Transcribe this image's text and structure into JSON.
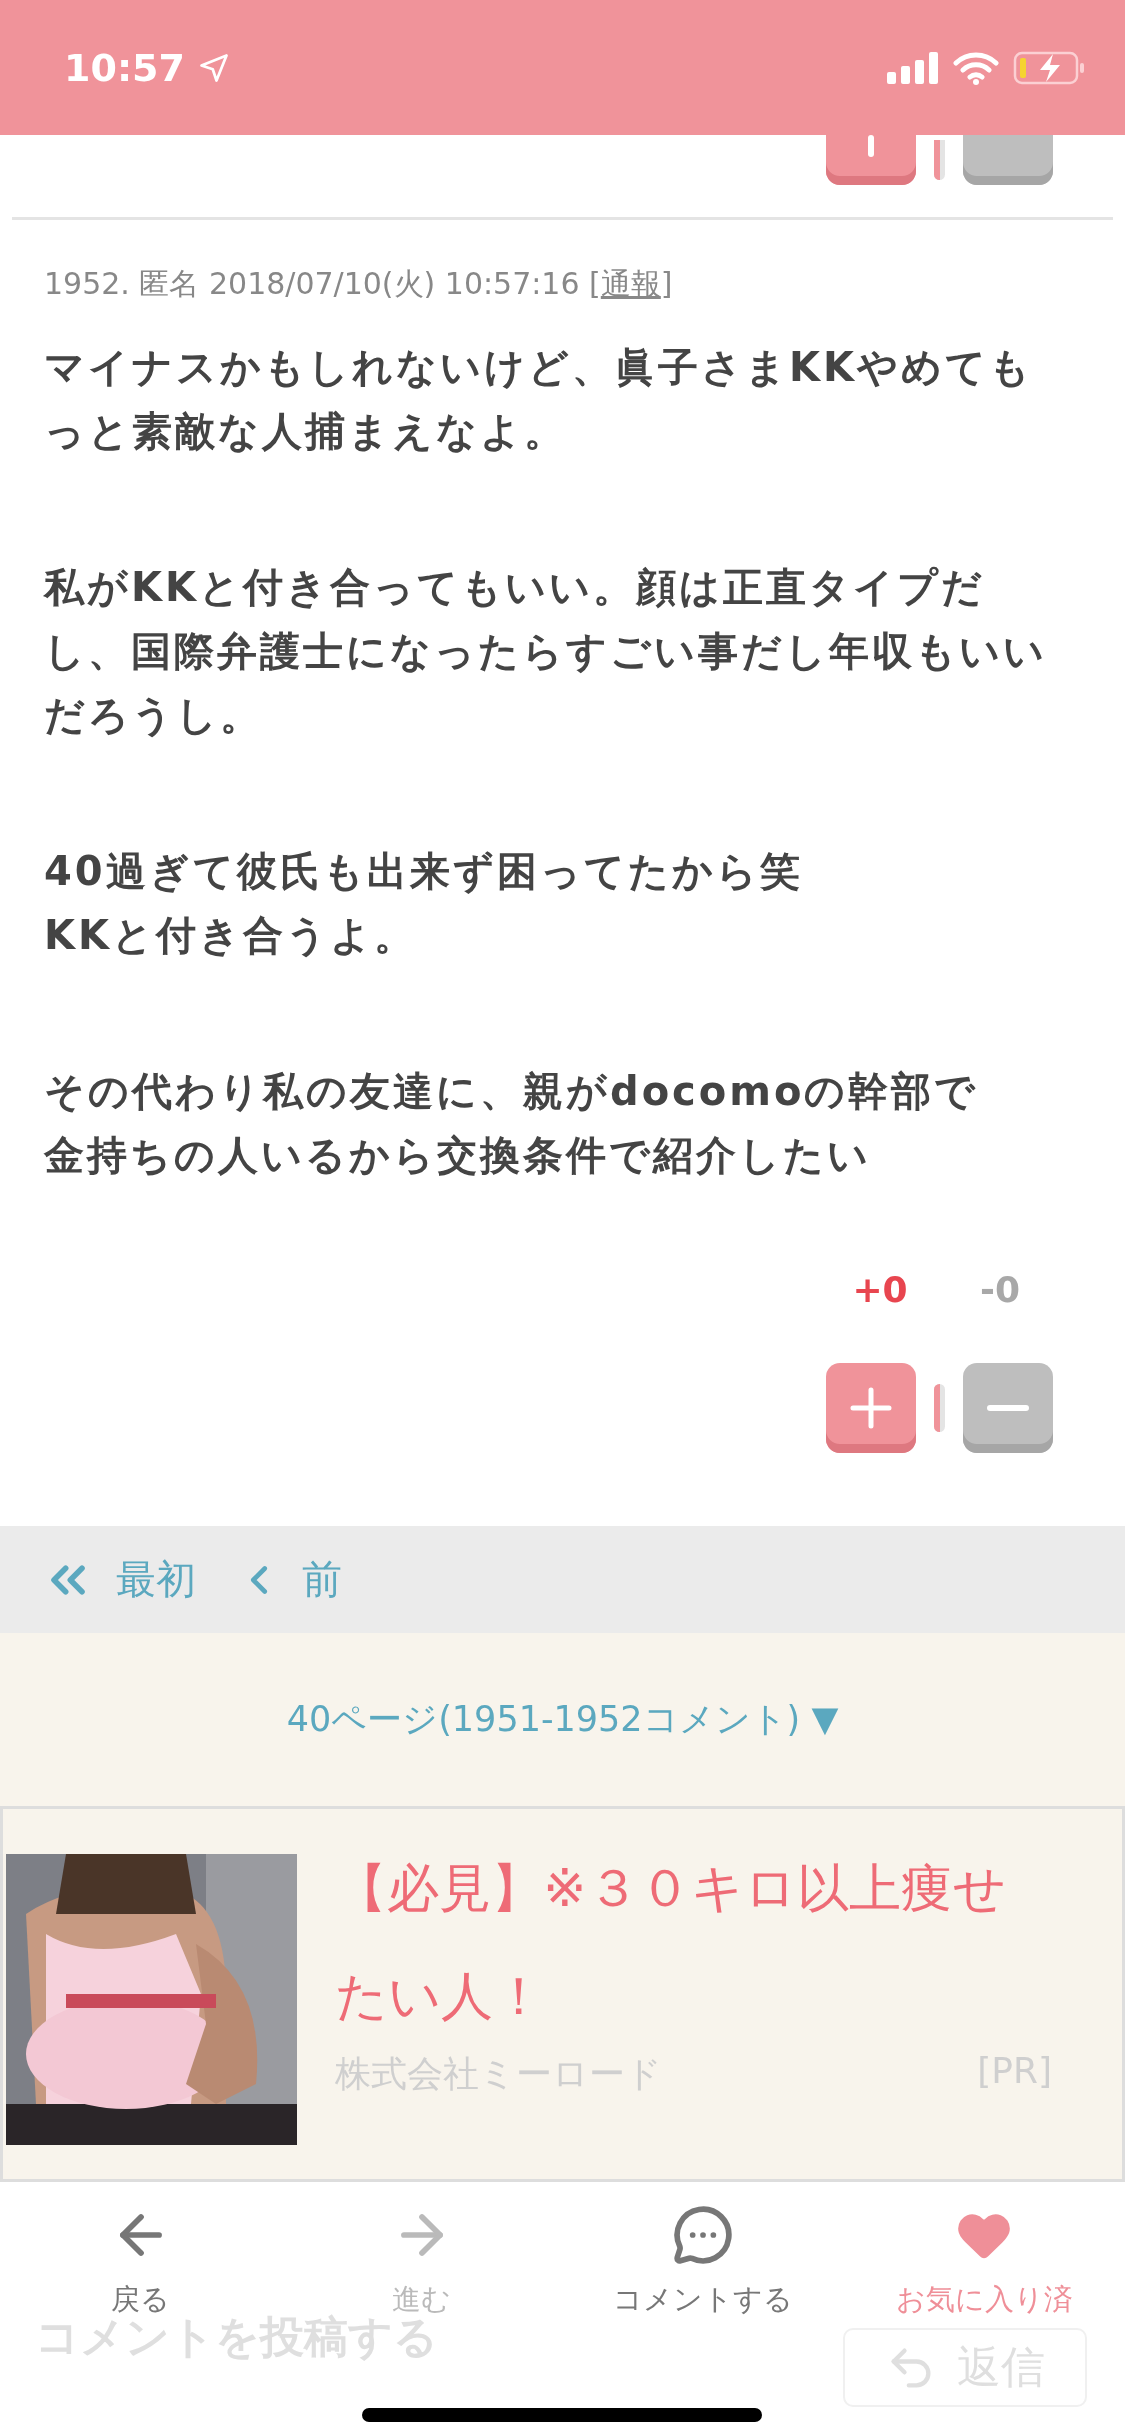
{
  "status_bar": {
    "time": "10:57"
  },
  "comment": {
    "meta": "1952. 匿名 2018/07/10(火) 10:57:16 [",
    "report_link": "通報",
    "meta_end": "]",
    "paragraphs": [
      [
        "マイナスかもしれないけど、眞子さまKKやめても",
        "っと素敵な人捕まえなよ。"
      ],
      [
        "私がKKと付き合ってもいい。顔は正直タイプだ",
        "し、国際弁護士になったらすごい事だし年収もいい",
        "だろうし。"
      ],
      [
        "40過ぎて彼氏も出来ず困ってたから笑",
        "KKと付き合うよ。"
      ],
      [
        "その代わり私の友達に、親がdocomoの幹部で",
        "金持ちの人いるから交換条件で紹介したい"
      ]
    ],
    "votes": {
      "plus": "+0",
      "minus": "-0"
    }
  },
  "pager": {
    "items": [
      {
        "kind": "first",
        "label": "最初"
      },
      {
        "kind": "prev",
        "label": "前"
      }
    ],
    "page_select": "40ページ(1951-1952コメント) ▼"
  },
  "ad": {
    "title": "【必見】※３０キロ以上痩せたい人！",
    "company": "株式会社ミーロード",
    "tag": "[PR]"
  },
  "post_form": {
    "title": "コメントを投稿する",
    "reply_button": "返信"
  },
  "toolbar": [
    {
      "kind": "back",
      "label": "戻る",
      "disabled": false,
      "active": false
    },
    {
      "kind": "forward",
      "label": "進む",
      "disabled": true,
      "active": false
    },
    {
      "kind": "comment",
      "label": "コメントする",
      "disabled": false,
      "active": false
    },
    {
      "kind": "favorite",
      "label": "お気に入り済",
      "disabled": false,
      "active": true
    }
  ]
}
